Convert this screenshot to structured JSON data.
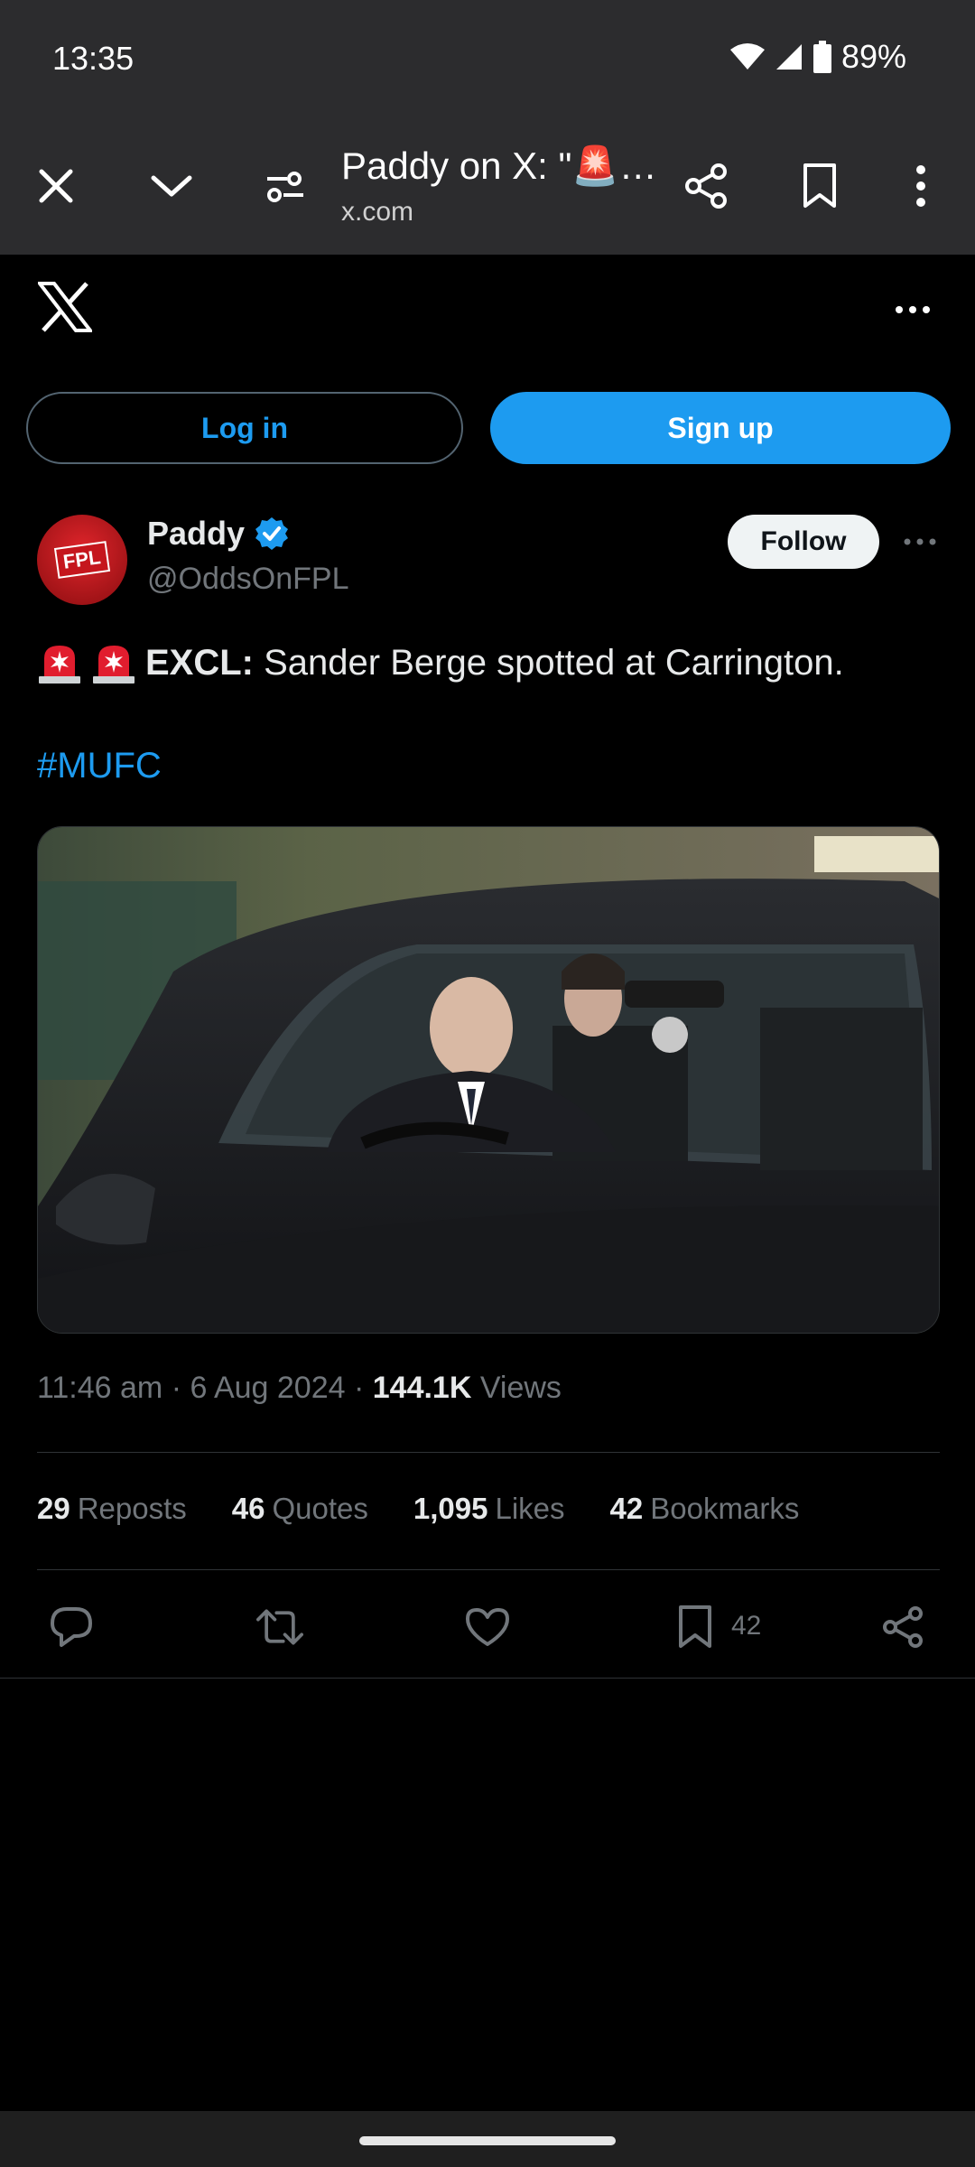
{
  "status": {
    "time": "13:35",
    "battery": "89%"
  },
  "browser": {
    "title": "Paddy on X: \"🚨…",
    "url": "x.com"
  },
  "auth": {
    "login": "Log in",
    "signup": "Sign up"
  },
  "tweet": {
    "author_name": "Paddy",
    "author_handle": "@OddsOnFPL",
    "follow": "Follow",
    "text_bold": "EXCL:",
    "text_rest": "Sander Berge spotted at Carrington.",
    "hashtag": "#MUFC",
    "time": "11:46 am",
    "date": "6 Aug 2024",
    "views_count": "144.1K",
    "views_label": "Views",
    "avatar_label": "FPL"
  },
  "stats": [
    {
      "num": "29",
      "label": "Reposts"
    },
    {
      "num": "46",
      "label": "Quotes"
    },
    {
      "num": "1,095",
      "label": "Likes"
    },
    {
      "num": "42",
      "label": "Bookmarks"
    }
  ],
  "actions": {
    "bookmark_count": "42"
  },
  "icons": [
    "close-icon",
    "chevron-down-icon",
    "page-info-icon",
    "share-icon",
    "bookmark-icon",
    "more-vertical-icon",
    "x-logo-icon",
    "more-horizontal-icon",
    "verified-badge-icon",
    "siren-icon",
    "reply-icon",
    "repost-icon",
    "like-icon",
    "bookmark-icon",
    "share-icon"
  ],
  "colors": {
    "accent": "#1d9bf0",
    "background": "#000000",
    "toolbar": "#2c2c2e",
    "muted": "#71767b"
  }
}
